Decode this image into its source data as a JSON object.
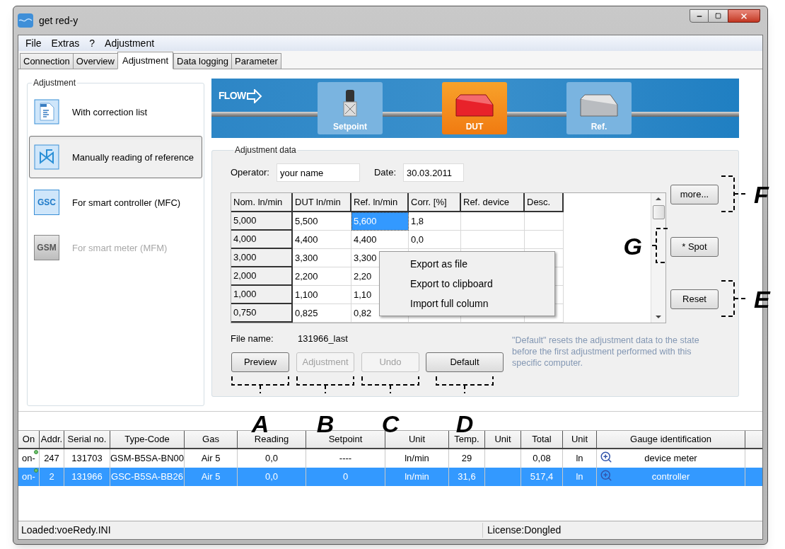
{
  "window": {
    "title": "get red-y"
  },
  "menu": [
    "File",
    "Extras",
    "?",
    "Adjustment"
  ],
  "tabs": [
    {
      "label": "Connection",
      "selected": false
    },
    {
      "label": "Overview",
      "selected": false
    },
    {
      "label": "Adjustment",
      "selected": true
    },
    {
      "label": "Data logging",
      "selected": false
    },
    {
      "label": "Parameter",
      "selected": false
    }
  ],
  "adjustment_group": {
    "title": "Adjustment",
    "items": [
      {
        "kind": "document",
        "label": "With correction list",
        "selected": false,
        "disabled": false
      },
      {
        "kind": "valve",
        "label": "Manually reading of reference",
        "selected": true,
        "disabled": false
      },
      {
        "kind": "badge",
        "badge": "GSC",
        "label": "For smart controller (MFC)",
        "selected": false,
        "disabled": false
      },
      {
        "kind": "badge",
        "badge": "GSM",
        "label": "For smart meter (MFM)",
        "selected": false,
        "disabled": true
      }
    ]
  },
  "flow_banner": {
    "flow_label": "FLOW",
    "stations": [
      {
        "kind": "valve",
        "label": "Setpoint",
        "selected": false
      },
      {
        "kind": "device",
        "label": "DUT",
        "selected": true
      },
      {
        "kind": "device",
        "label": "Ref.",
        "selected": false
      }
    ]
  },
  "adjustment_data": {
    "title": "Adjustment data",
    "operator_label": "Operator:",
    "operator": "your name",
    "date_label": "Date:",
    "date": "30.03.2011",
    "columns": [
      "Nom. ln/min",
      "DUT ln/min",
      "Ref. ln/min",
      "Corr. [%]",
      "Ref. device",
      "Desc."
    ],
    "rows": [
      {
        "cells": [
          {
            "text": "5,000",
            "selected": false
          },
          {
            "text": "5,500",
            "selected": false
          },
          {
            "text": "5,600",
            "selected": true
          },
          {
            "text": "1,8",
            "selected": false
          }
        ]
      },
      {
        "cells": [
          {
            "text": "4,000",
            "selected": false
          },
          {
            "text": "4,400",
            "selected": false
          },
          {
            "text": "4,400",
            "selected": false
          },
          {
            "text": "0,0",
            "selected": false
          }
        ]
      },
      {
        "cells": [
          {
            "text": "3,000",
            "selected": false
          },
          {
            "text": "3,300",
            "selected": false
          },
          {
            "text": "3,300",
            "selected": false
          }
        ]
      },
      {
        "cells": [
          {
            "text": "2,000",
            "selected": false
          },
          {
            "text": "2,200",
            "selected": false
          },
          {
            "text": "2,20",
            "selected": false
          }
        ]
      },
      {
        "cells": [
          {
            "text": "1,000",
            "selected": false
          },
          {
            "text": "1,100",
            "selected": false
          },
          {
            "text": "1,10",
            "selected": false
          }
        ]
      },
      {
        "cells": [
          {
            "text": "0,750",
            "selected": false
          },
          {
            "text": "0,825",
            "selected": false
          },
          {
            "text": "0,82",
            "selected": false
          }
        ]
      }
    ],
    "context_menu": [
      "Export as file",
      "Export to clipboard",
      "Import full column"
    ],
    "side_buttons": [
      {
        "label": "more...",
        "callout": "F"
      },
      {
        "label": "* Spot",
        "callout": "G"
      },
      {
        "label": "Reset",
        "callout": "E"
      }
    ],
    "file_name_label": "File name:",
    "file_name": "131966_last",
    "buttons": [
      {
        "label": "Preview",
        "disabled": false,
        "callout": "A"
      },
      {
        "label": "Adjustment",
        "disabled": true,
        "callout": "B"
      },
      {
        "label": "Undo",
        "disabled": true,
        "callout": "C"
      },
      {
        "label": "Default",
        "disabled": false,
        "callout": "D"
      }
    ],
    "hint": "\"Default\" resets the adjustment data to the state before the first adjustment performed with this specific computer."
  },
  "device_table": {
    "columns": [
      "On",
      "Addr.",
      "Serial no.",
      "Type-Code",
      "Gas",
      "Reading",
      "Setpoint",
      "Unit",
      "Temp.",
      "Unit",
      "Total",
      "Unit",
      "Gauge identification"
    ],
    "rows": [
      {
        "selected": false,
        "cells": [
          "on-",
          "247",
          "131703",
          "GSM-B5SA-BN00",
          "Air 5",
          "0,0",
          "----",
          "ln/min",
          "29",
          null,
          "0,08",
          "ln",
          "device meter"
        ]
      },
      {
        "selected": true,
        "cells": [
          "on-",
          "2",
          "131966",
          "GSC-B5SA-BB26",
          "Air 5",
          "0,0",
          "0",
          "ln/min",
          "31,6",
          null,
          "517,4",
          "ln",
          "controller"
        ]
      }
    ]
  },
  "status_bar": [
    "Loaded:voeRedy.INI",
    "License:Dongled"
  ]
}
